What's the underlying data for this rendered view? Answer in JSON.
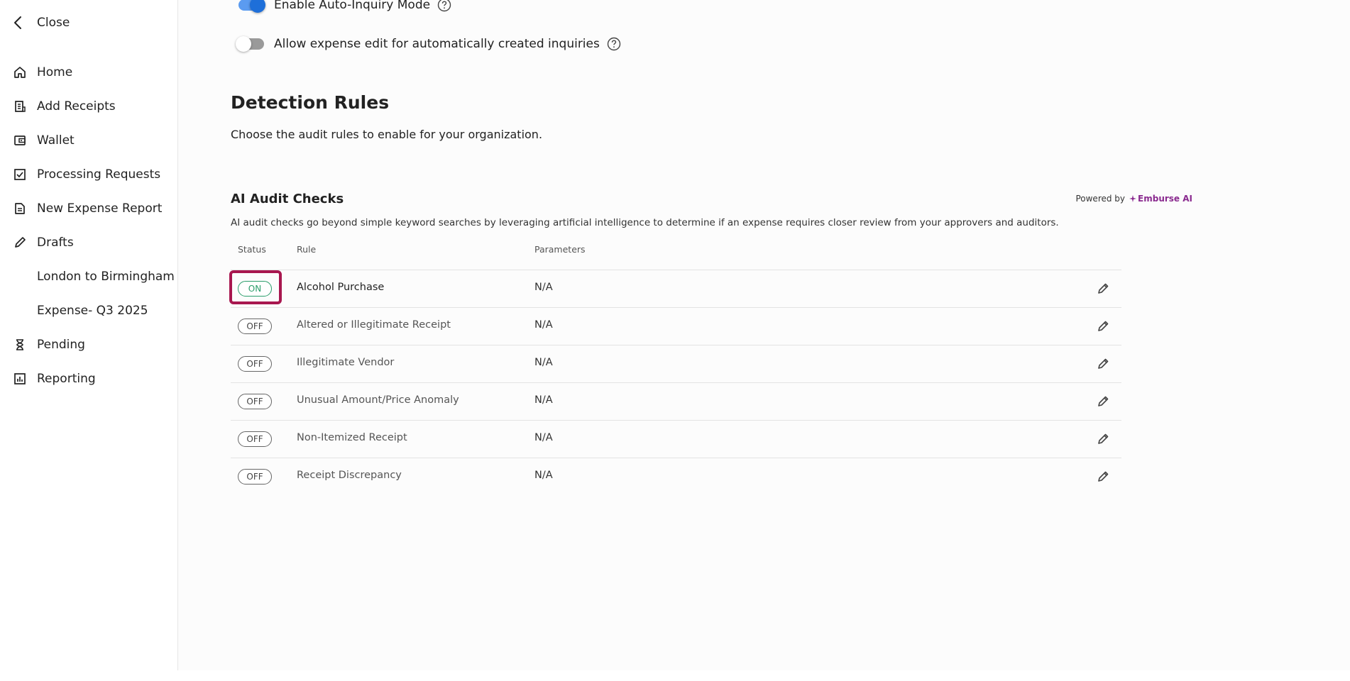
{
  "sidebar": {
    "close_label": "Close",
    "items": [
      {
        "label": "Home",
        "icon": "home-icon"
      },
      {
        "label": "Add Receipts",
        "icon": "receipt-icon"
      },
      {
        "label": "Wallet",
        "icon": "wallet-icon"
      },
      {
        "label": "Processing Requests",
        "icon": "checkbox-icon"
      },
      {
        "label": "New Expense Report",
        "icon": "report-icon"
      },
      {
        "label": "Drafts",
        "icon": "pencil-icon"
      }
    ],
    "drafts": [
      "London to Birmingham",
      "Expense- Q3 2025"
    ],
    "items_after": [
      {
        "label": "Pending",
        "icon": "hourglass-icon"
      },
      {
        "label": "Reporting",
        "icon": "chart-icon"
      }
    ]
  },
  "settings": {
    "auto_inquiry_label": "Enable Auto-Inquiry Mode",
    "auto_inquiry_on": true,
    "allow_edit_label": "Allow expense edit for automatically created inquiries",
    "allow_edit_on": false
  },
  "detection": {
    "title": "Detection Rules",
    "description": "Choose the audit rules to enable for your organization."
  },
  "audit": {
    "title": "AI Audit Checks",
    "powered_by": "Powered by",
    "brand": "Emburse AI",
    "brand_color": "#8a2a8f",
    "description": "AI audit checks go beyond simple keyword searches by leveraging artificial intelligence to determine if an expense requires closer review from your approvers and auditors.",
    "columns": {
      "status": "Status",
      "rule": "Rule",
      "parameters": "Parameters"
    },
    "rows": [
      {
        "status": "ON",
        "rule": "Alcohol Purchase",
        "parameters": "N/A"
      },
      {
        "status": "OFF",
        "rule": "Altered or Illegitimate Receipt",
        "parameters": "N/A"
      },
      {
        "status": "OFF",
        "rule": "Illegitimate Vendor",
        "parameters": "N/A"
      },
      {
        "status": "OFF",
        "rule": "Unusual Amount/Price Anomaly",
        "parameters": "N/A"
      },
      {
        "status": "OFF",
        "rule": "Non-Itemized Receipt",
        "parameters": "N/A"
      },
      {
        "status": "OFF",
        "rule": "Receipt Discrepancy",
        "parameters": "N/A"
      }
    ]
  },
  "colors": {
    "on": "#2a9d6a",
    "toggle_on": "#1e6fd9",
    "focus": "#a8174f"
  }
}
